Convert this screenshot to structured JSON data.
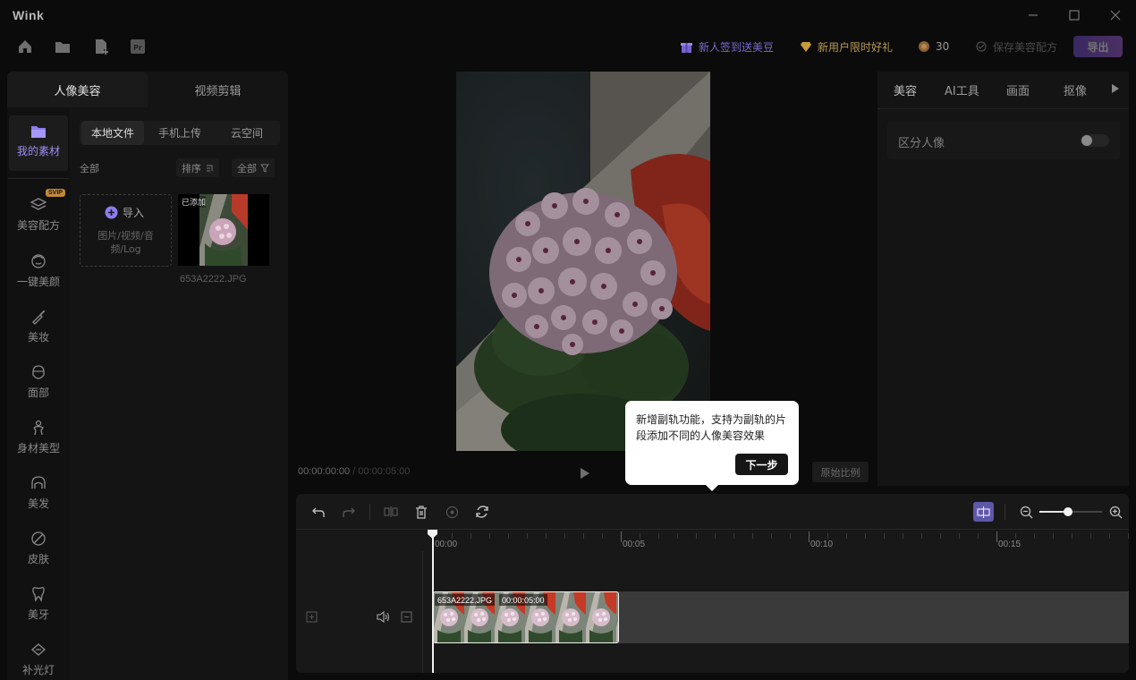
{
  "app": {
    "title": "Wink"
  },
  "header": {
    "signin_label": "新人签到送美豆",
    "gift_label": "新用户限时好礼",
    "beans_count": "30",
    "save_recipe_label": "保存美容配方",
    "export_label": "导出"
  },
  "left_tabs": {
    "portrait": "人像美容",
    "video_edit": "视频剪辑"
  },
  "sidebar": {
    "items": [
      {
        "label": "我的素材",
        "icon": "folder-icon"
      },
      {
        "label": "美容配方",
        "icon": "layers-icon",
        "badge": "SVIP"
      },
      {
        "label": "一键美颜",
        "icon": "face-icon"
      },
      {
        "label": "美妆",
        "icon": "makeup-brush-icon"
      },
      {
        "label": "面部",
        "icon": "face-outline-icon"
      },
      {
        "label": "身材美型",
        "icon": "body-icon"
      },
      {
        "label": "美发",
        "icon": "hair-icon"
      },
      {
        "label": "皮肤",
        "icon": "skin-icon"
      },
      {
        "label": "美牙",
        "icon": "tooth-icon"
      },
      {
        "label": "补光灯",
        "icon": "light-icon"
      }
    ]
  },
  "media": {
    "sub_tabs": [
      "本地文件",
      "手机上传",
      "云空间"
    ],
    "filter_all": "全部",
    "sort_label": "排序",
    "filter_label": "全部",
    "import_label": "导入",
    "import_hint": "图片/视频/音频/Log",
    "thumb_badge": "已添加",
    "thumb_name": "653A2222.JPG"
  },
  "preview": {
    "time_current": "00:00:00:00",
    "time_total": "/ 00:00:05:00",
    "ratio_label": "原始比例"
  },
  "right_panel": {
    "tabs": [
      "美容",
      "AI工具",
      "画面",
      "抠像"
    ],
    "toggle_label": "区分人像",
    "toggle_on": false
  },
  "timeline": {
    "ticks": [
      "00:00",
      "00:05",
      "00:10",
      "00:15"
    ],
    "clip_name": "653A2222.JPG",
    "clip_duration": "00:00:05:00",
    "zoom_level": 0.45
  },
  "popup": {
    "text": "新增副轨功能，支持为副轨的片段添加不同的人像美容效果",
    "next_label": "下一步"
  },
  "colors": {
    "accent": "#8b7cf0",
    "export_start": "#7a5bd6",
    "export_end": "#a86adc",
    "svip": "#c2883a"
  }
}
